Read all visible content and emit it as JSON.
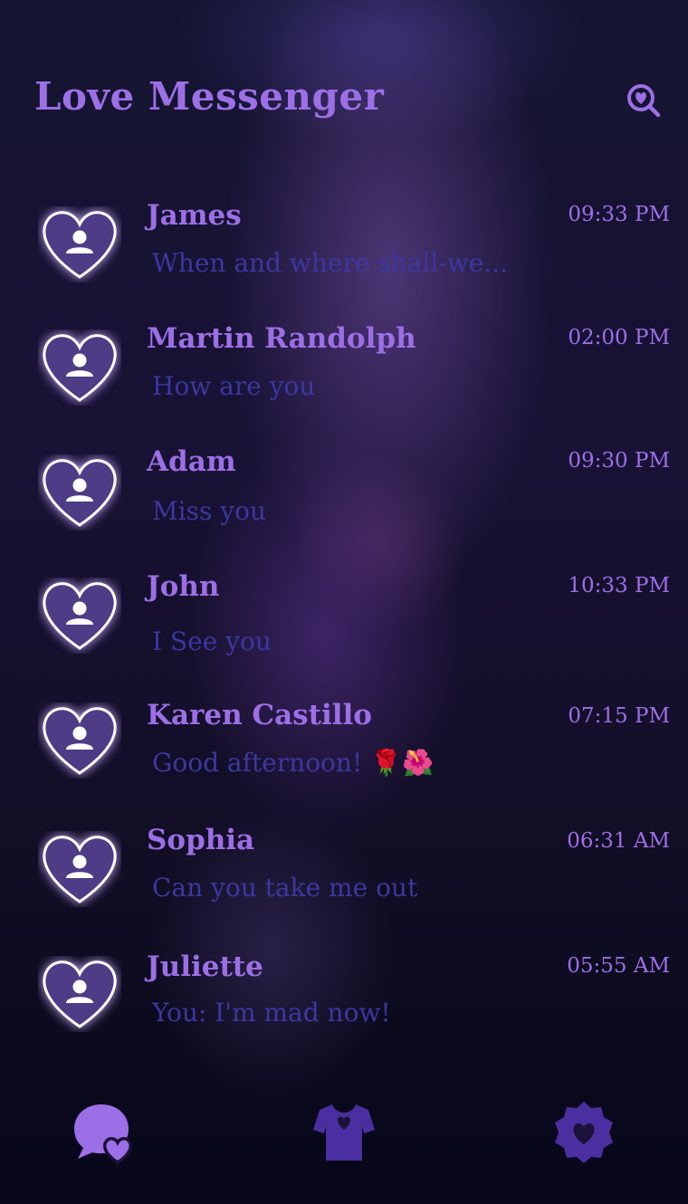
{
  "app": {
    "title": "Love Messenger"
  },
  "header": {
    "search_icon": "heart-search-icon"
  },
  "chats": [
    {
      "name": "James",
      "time": "09:33 PM",
      "preview": "When and where shall-we..."
    },
    {
      "name": "Martin Randolph",
      "time": "02:00 PM",
      "preview": "How are you"
    },
    {
      "name": "Adam",
      "time": "09:30 PM",
      "preview": "Miss you"
    },
    {
      "name": "John",
      "time": "10:33 PM",
      "preview": "I See you"
    },
    {
      "name": "Karen Castillo",
      "time": "07:15 PM",
      "preview": "Good afternoon! 🌹🌺"
    },
    {
      "name": "Sophia",
      "time": "06:31 AM",
      "preview": "Can you take me out"
    },
    {
      "name": "Juliette",
      "time": "05:55 AM",
      "preview": "You: I'm mad now!"
    }
  ],
  "nav": {
    "items": [
      {
        "icon": "chat-heart-icon",
        "active": true
      },
      {
        "icon": "shirt-heart-icon",
        "active": false
      },
      {
        "icon": "settings-heart-icon",
        "active": false
      }
    ]
  },
  "colors": {
    "accent": "#9d6fe6",
    "preview_text": "#3a38a0",
    "nav_inactive": "#4a2fa0"
  }
}
